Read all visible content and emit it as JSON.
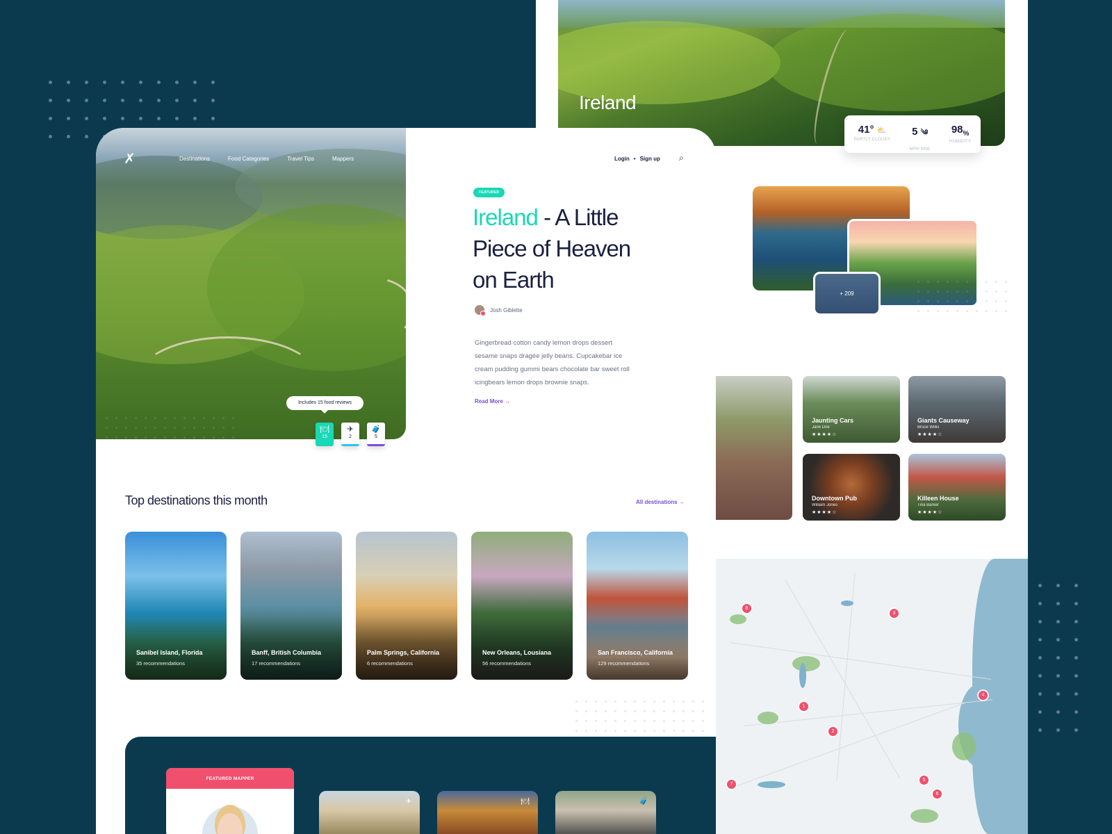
{
  "ireland_card": {
    "title": "Ireland",
    "weather": [
      {
        "value": "41°",
        "icon": "partly-cloudy-icon",
        "icon_glyph": "⛅",
        "label": "PARTLY CLOUDY"
      },
      {
        "value": "5",
        "icon": "wind-icon",
        "icon_glyph": "༄",
        "label": "MPH NNE"
      },
      {
        "value": "98",
        "unit": "%",
        "label": "HUMIDITY"
      }
    ]
  },
  "photo_count": "+ 209",
  "reviews": [
    {
      "name": "Jaunting Cars",
      "author": "Jane Doe",
      "stars": "★★★★☆"
    },
    {
      "name": "Giants Causeway",
      "author": "Bruce Willis",
      "stars": "★★★★☆"
    },
    {
      "name": "Downtown Pub",
      "author": "William Jones",
      "stars": "★★★★☆"
    },
    {
      "name": "Killeen House",
      "author": "Tina Barker",
      "stars": "★★★★☆"
    }
  ],
  "map": {
    "pins": [
      "8",
      "3",
      "1",
      "2",
      "4",
      "7",
      "5",
      "6"
    ]
  },
  "nav": {
    "items": [
      "Destinations",
      "Food Categories",
      "Travel Tips",
      "Mappers"
    ],
    "login": "Login",
    "signup": "Sign up",
    "separator": "•"
  },
  "hero": {
    "tooltip": "Includes 15 food reviews",
    "stats": [
      {
        "icon": "food-icon",
        "glyph": "🍽",
        "value": "15"
      },
      {
        "icon": "plane-icon",
        "glyph": "✈",
        "value": "2"
      },
      {
        "icon": "luggage-icon",
        "glyph": "🧳",
        "value": "5"
      }
    ]
  },
  "article": {
    "badge": "FEATURED",
    "headline_highlight": "Ireland",
    "headline_rest": " - A Little Piece of Heaven on Earth",
    "author": "Josh Giblette",
    "description": "Gingerbread cotton candy lemon drops dessert sesame snaps dragée jelly beans. Cupcakebar ice cream pudding gummi bears chocolate bar sweet roll icingbears lemon drops brownie snaps.",
    "read_more": "Read More"
  },
  "destinations": {
    "title": "Top destinations this month",
    "all_label": "All destinations",
    "items": [
      {
        "name": "Sanibel Island, Florida",
        "recs": "35 recommendations"
      },
      {
        "name": "Banff, British Columbia",
        "recs": "17 recommendations"
      },
      {
        "name": "Palm Springs, California",
        "recs": "6 recommendations"
      },
      {
        "name": "New Orleans, Lousiana",
        "recs": "56 recommendations"
      },
      {
        "name": "San Francisco, California",
        "recs": "129 recommendations"
      }
    ]
  },
  "mapper": {
    "header": "FEATURED MAPPER"
  },
  "colors": {
    "accent_teal": "#19d8b4",
    "accent_purple": "#7a4fd6",
    "accent_pink": "#f0506e",
    "navy": "#0b3a4f",
    "text_dark": "#1a2040"
  }
}
